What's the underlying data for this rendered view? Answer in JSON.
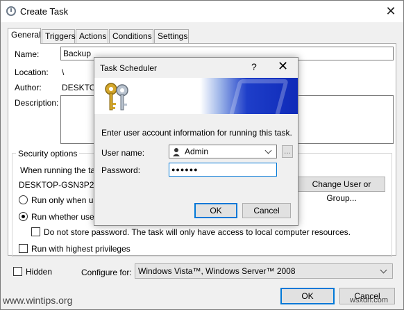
{
  "window": {
    "title": "Create Task",
    "close_glyph": "✕"
  },
  "tabs": [
    "General",
    "Triggers",
    "Actions",
    "Conditions",
    "Settings"
  ],
  "general": {
    "name_label": "Name:",
    "name_value": "Backup",
    "location_label": "Location:",
    "location_value": "\\",
    "author_label": "Author:",
    "author_value": "DESKTOP",
    "description_label": "Description:",
    "security": {
      "legend": "Security options",
      "when_running": "When running the tas",
      "user_account": "DESKTOP-GSN3P2N\\",
      "change_button": "Change User or Group...",
      "run_only_label": "Run only when use",
      "run_whether_label": "Run whether user i",
      "no_store_label": "Do not store password.  The task will only have access to local computer resources.",
      "highest_label": "Run with highest privileges"
    },
    "hidden_label": "Hidden",
    "configure_label": "Configure for:",
    "configure_value": "Windows Vista™, Windows Server™ 2008"
  },
  "footer": {
    "ok": "OK",
    "cancel": "Cancel"
  },
  "modal": {
    "title": "Task Scheduler",
    "help_glyph": "?",
    "close_glyph": "✕",
    "prompt": "Enter user account information for running this task.",
    "username_label": "User name:",
    "username_value": "Admin",
    "browse_glyph": "...",
    "password_label": "Password:",
    "password_value": "●●●●●●",
    "ok": "OK",
    "cancel": "Cancel"
  },
  "watermarks": {
    "left": "www.wintips.org",
    "right": "wsxdn.com"
  }
}
